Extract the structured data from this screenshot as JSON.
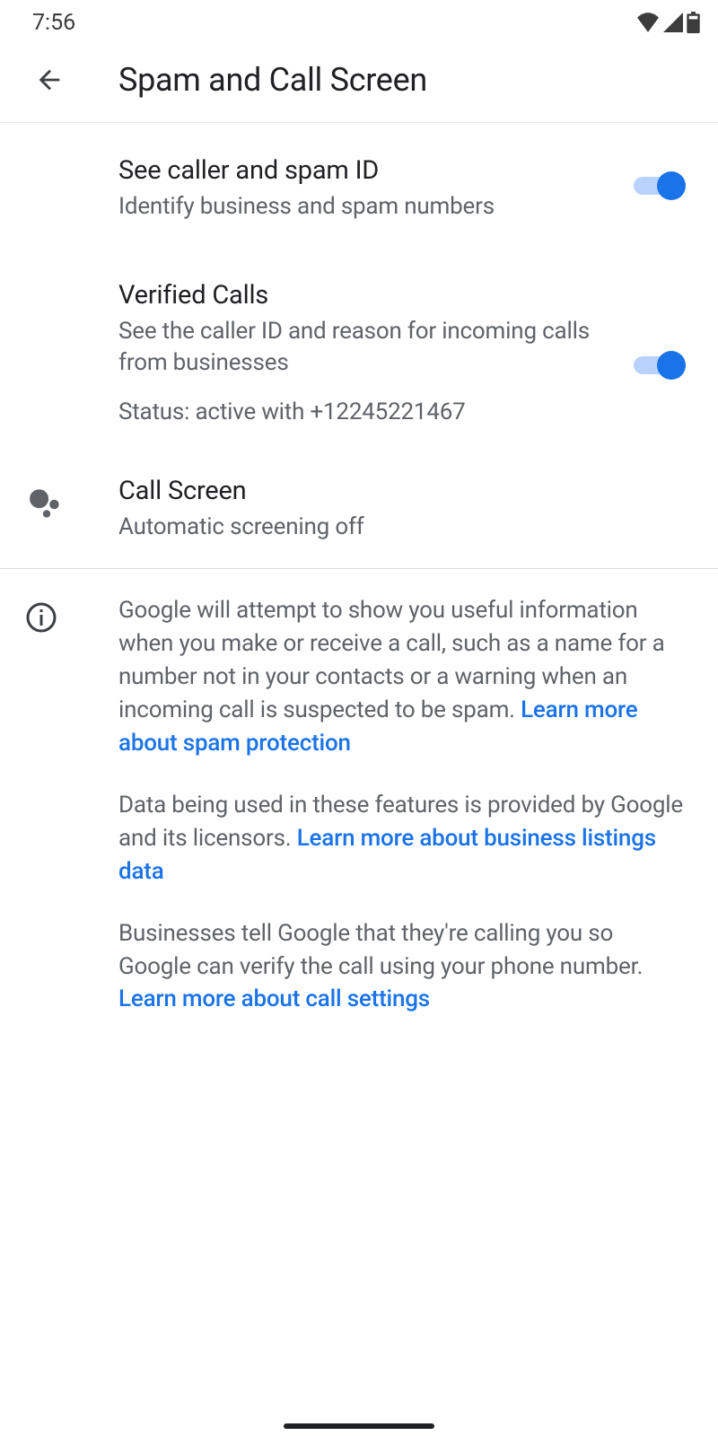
{
  "status_bar": {
    "time": "7:56"
  },
  "header": {
    "title": "Spam and Call Screen"
  },
  "settings": {
    "caller_spam_id": {
      "title": "See caller and spam ID",
      "subtitle": "Identify business and spam numbers",
      "enabled": true
    },
    "verified_calls": {
      "title": "Verified Calls",
      "subtitle": "See the caller ID and reason for incoming calls from businesses",
      "status": "Status: active with +12245221467",
      "enabled": true
    },
    "call_screen": {
      "title": "Call Screen",
      "subtitle": "Automatic screening off"
    }
  },
  "info": {
    "para1_text": "Google will attempt to show you useful information when you make or receive a call, such as a name for a number not in your contacts or a warning when an incoming call is suspected to be spam. ",
    "para1_link": "Learn more about spam protection",
    "para2_text": "Data being used in these features is provided by Google and its licensors. ",
    "para2_link": "Learn more about business listings data",
    "para3_text": "Businesses tell Google that they're calling you so Google can verify the call using your phone number. ",
    "para3_link": "Learn more about call settings"
  }
}
